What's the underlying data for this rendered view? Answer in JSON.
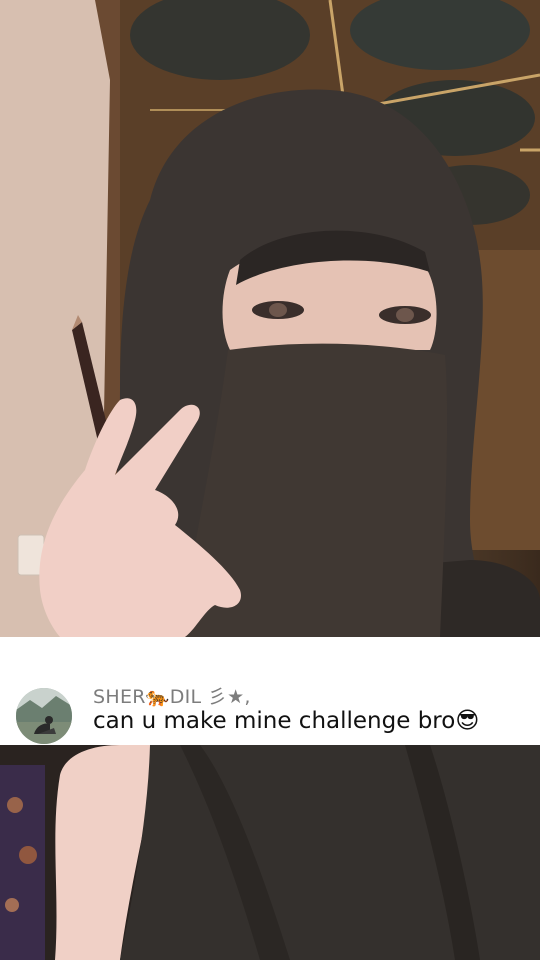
{
  "comment": {
    "username": "SHER🐅DIL 彡★,",
    "text": "can u make mine challenge bro😎"
  },
  "colors": {
    "card_background": "#ffffff",
    "username_color": "#7d7d7d",
    "text_color": "#111111",
    "niqab": "#3a3431"
  },
  "icons": {
    "avatar": "person-sitting-on-rock-photo"
  }
}
